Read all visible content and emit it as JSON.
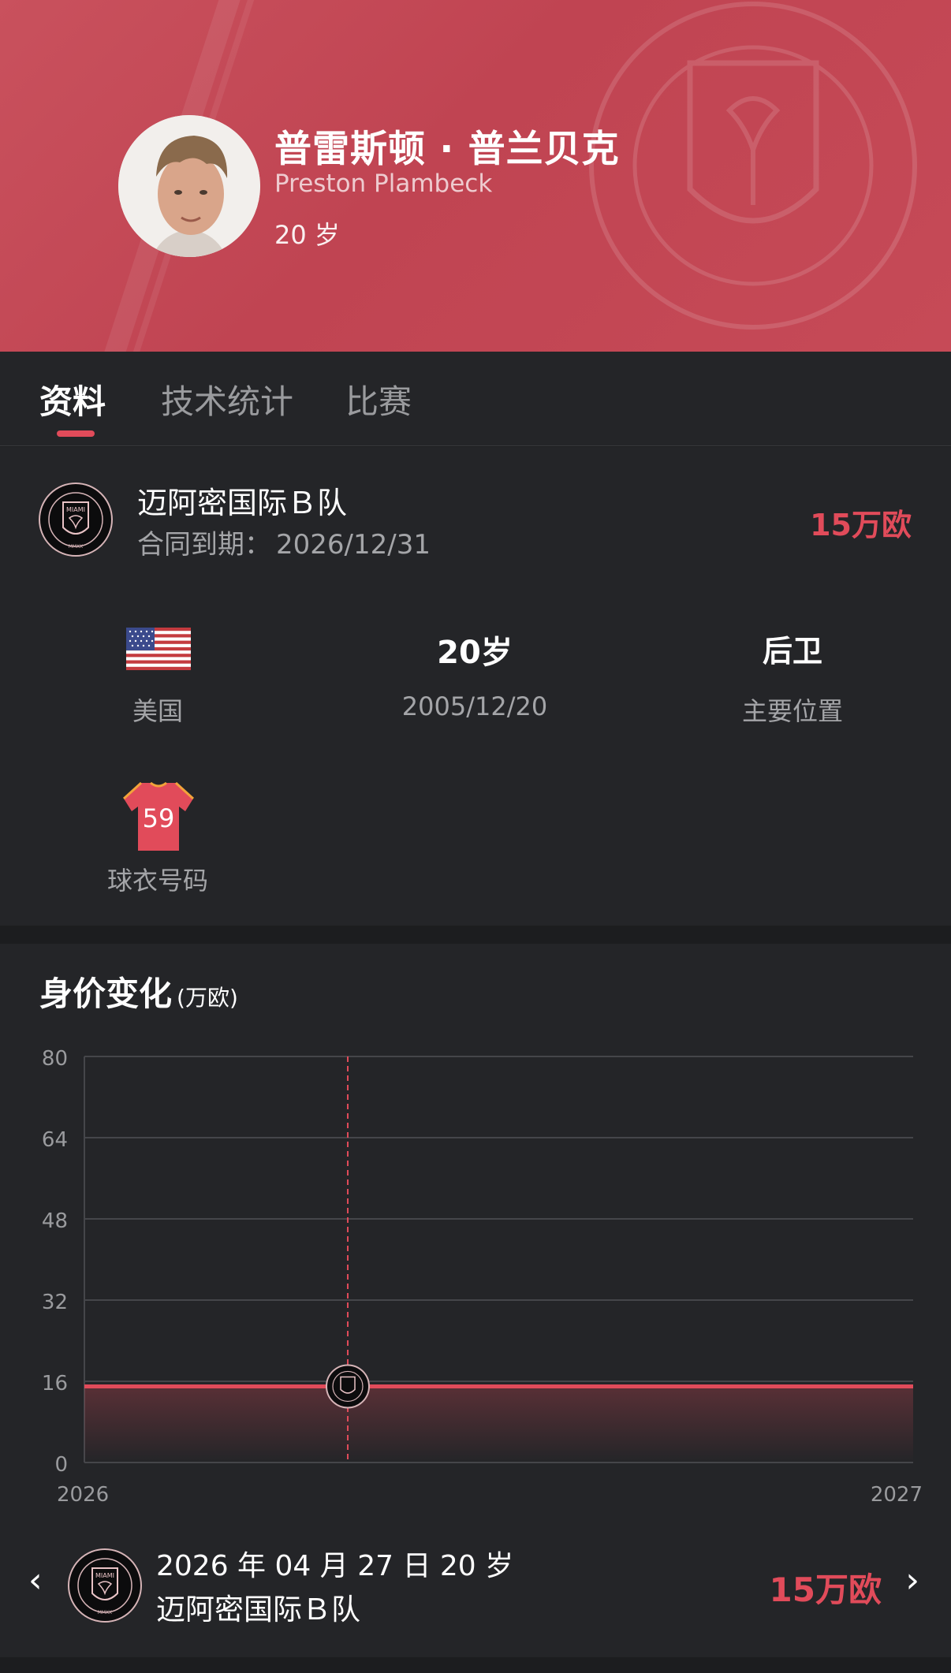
{
  "player": {
    "name_cn": "普雷斯顿 · 普兰贝克",
    "name_en": "Preston Plambeck",
    "age": "20 岁"
  },
  "tabs": [
    {
      "label": "资料",
      "active": true
    },
    {
      "label": "技术统计",
      "active": false
    },
    {
      "label": "比赛",
      "active": false
    }
  ],
  "club": {
    "name": "迈阿密国际Ｂ队",
    "contract_label": "合同到期：",
    "contract_end": "2026/12/31",
    "market_value": "15万欧",
    "logo_icon": "inter-miami-crest-icon"
  },
  "details": {
    "nationality": {
      "icon": "usa-flag-icon",
      "label": "美国"
    },
    "age": {
      "value": "20岁",
      "birthdate": "2005/12/20"
    },
    "position": {
      "value": "后卫",
      "label": "主要位置"
    },
    "shirt": {
      "number": "59",
      "label": "球衣号码",
      "icon": "jersey-icon"
    }
  },
  "chart_section": {
    "title": "身价变化",
    "unit": "(万欧)"
  },
  "chart_data": {
    "type": "line",
    "title": "身价变化",
    "ylabel": "(万欧)",
    "y_ticks": [
      "80",
      "64",
      "48",
      "32",
      "16",
      "0"
    ],
    "ylim": [
      0,
      80
    ],
    "x_ticks": [
      "2026",
      "2027"
    ],
    "xlim": [
      2026,
      2027
    ],
    "series": [
      {
        "values": [
          {
            "x": 2026,
            "y": 15
          },
          {
            "x": 2027,
            "y": 15
          }
        ]
      }
    ],
    "highlight_point": {
      "x": "2026-04-27",
      "y": 15
    },
    "grid": true,
    "legend": "none",
    "line_color": "#e14b5a"
  },
  "selected_point": {
    "date": "2026 年 04 月 27 日  20 岁",
    "club": "迈阿密国际Ｂ队",
    "value": "15万欧",
    "prev_label": "‹",
    "next_label": "›"
  },
  "colors": {
    "accent": "#e14b5a",
    "header_bg": "#c34856",
    "panel_bg": "#242528"
  }
}
